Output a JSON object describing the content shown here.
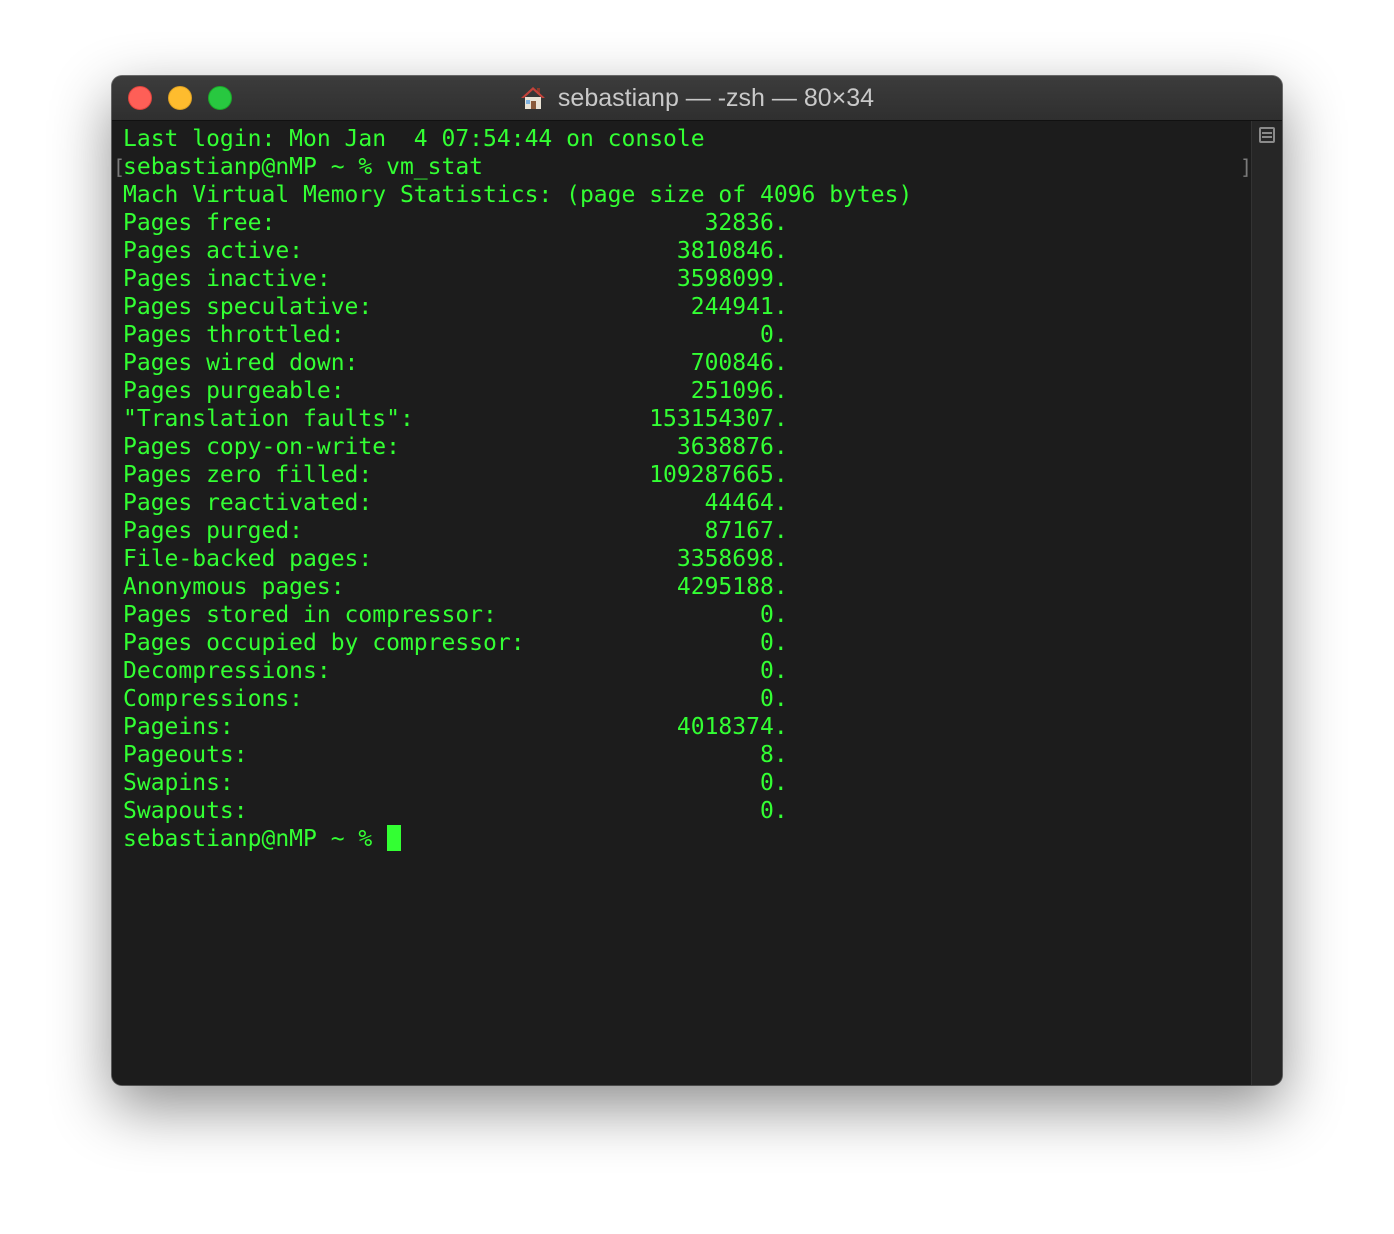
{
  "window": {
    "title": "sebastianp — -zsh — 80×34",
    "icon": "home-folder-icon"
  },
  "terminal": {
    "fg_color": "#33ff33",
    "bg_color": "#1c1c1c",
    "login": "Last login: Mon Jan  4 07:54:44 on console",
    "command_line": "sebastianp@nMP ~ % vm_stat",
    "header": "Mach Virtual Memory Statistics: (page size of 4096 bytes)",
    "stats": [
      "Pages free:                               32836.",
      "Pages active:                           3810846.",
      "Pages inactive:                         3598099.",
      "Pages speculative:                       244941.",
      "Pages throttled:                              0.",
      "Pages wired down:                        700846.",
      "Pages purgeable:                         251096.",
      "\"Translation faults\":                 153154307.",
      "Pages copy-on-write:                    3638876.",
      "Pages zero filled:                    109287665.",
      "Pages reactivated:                        44464.",
      "Pages purged:                             87167.",
      "File-backed pages:                      3358698.",
      "Anonymous pages:                        4295188.",
      "Pages stored in compressor:                   0.",
      "Pages occupied by compressor:                 0.",
      "Decompressions:                               0.",
      "Compressions:                                 0.",
      "Pageins:                                4018374.",
      "Pageouts:                                     8.",
      "Swapins:                                      0.",
      "Swapouts:                                     0."
    ],
    "prompt": "sebastianp@nMP ~ % ",
    "mark_left": "[",
    "mark_right": "]"
  }
}
